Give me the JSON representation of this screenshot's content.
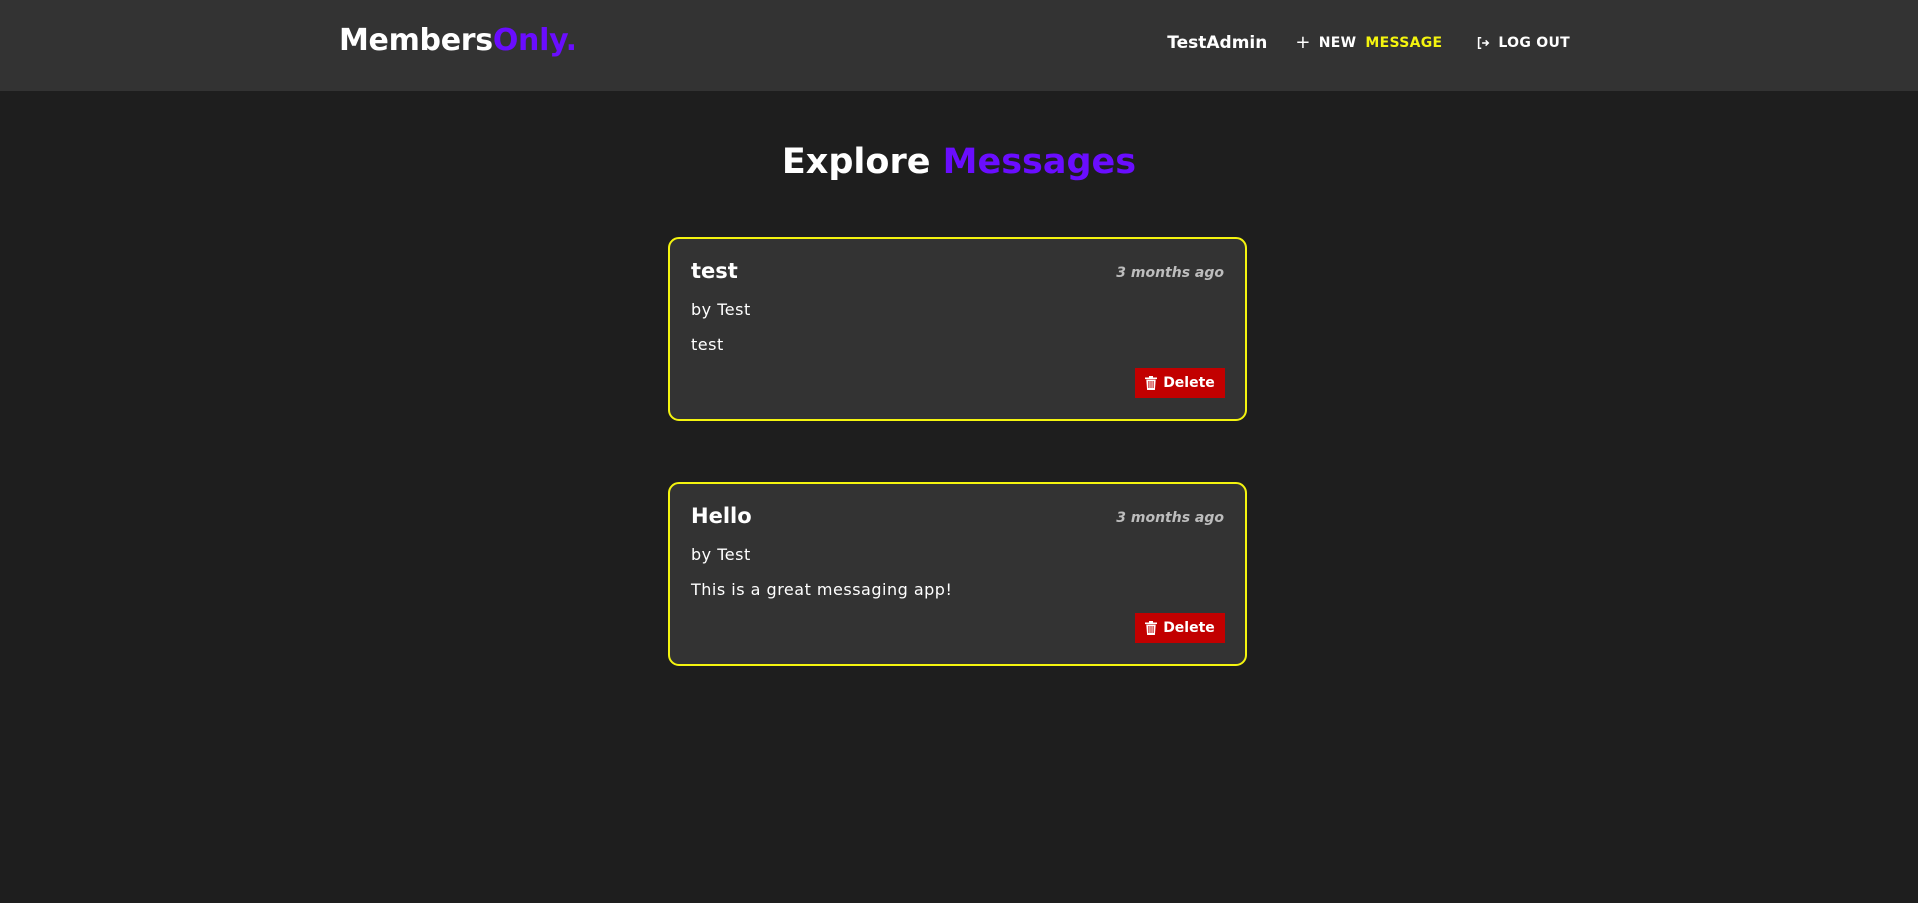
{
  "header": {
    "logo_main": "Members",
    "logo_accent": "Only.",
    "username": "TestAdmin",
    "new_label": "NEW",
    "new_accent": "MESSAGE",
    "logout_label": "LOG OUT"
  },
  "page": {
    "title_main": "Explore",
    "title_accent": "Messages"
  },
  "messages": [
    {
      "title": "test",
      "time": "3 months ago",
      "author": "by Test",
      "body": "test",
      "delete_label": "Delete"
    },
    {
      "title": "Hello",
      "time": "3 months ago",
      "author": "by Test",
      "body": "This is a great messaging app!",
      "delete_label": "Delete"
    }
  ],
  "colors": {
    "accent_purple": "#6a0dff",
    "accent_yellow": "#f4f40f",
    "delete_red": "#c20000",
    "header_bg": "#333333",
    "page_bg": "#1e1e1e"
  },
  "icons": {
    "new_message": "plus-icon",
    "logout": "logout-icon",
    "delete": "trash-icon"
  }
}
